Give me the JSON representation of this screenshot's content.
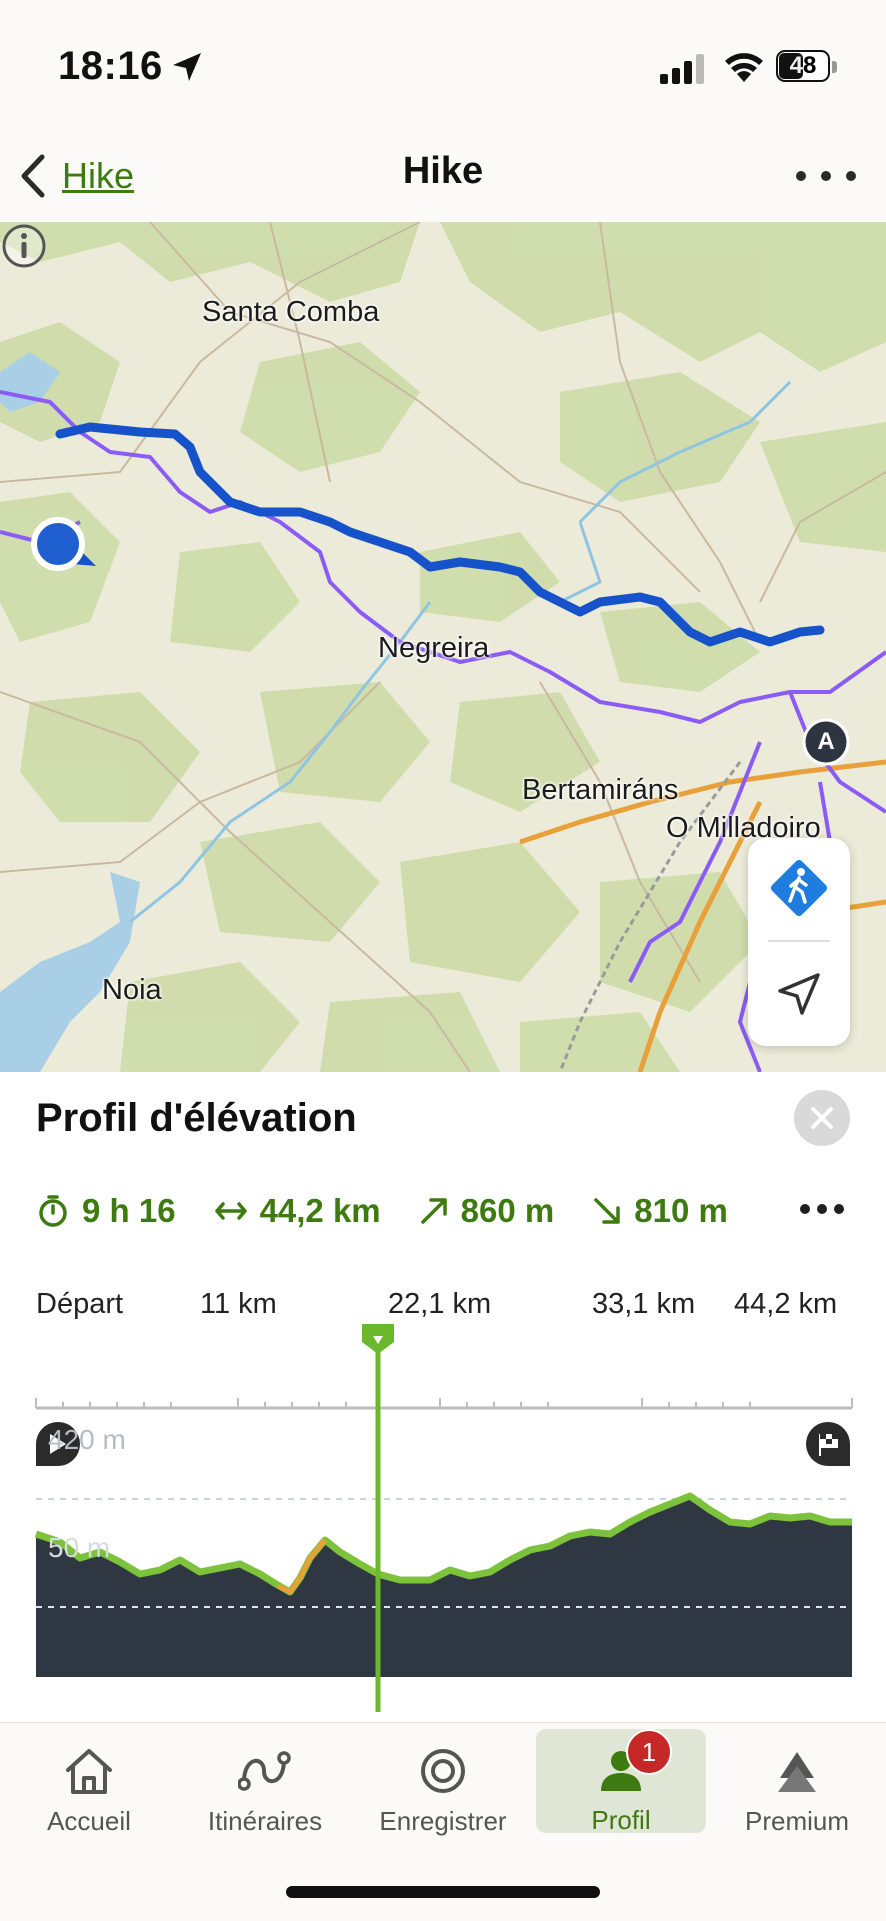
{
  "status_bar": {
    "time": "18:16",
    "battery": "48"
  },
  "nav": {
    "back_label": "Hike",
    "title": "Hike"
  },
  "map": {
    "labels": {
      "santa_comba": "Santa Comba",
      "negreira": "Negreira",
      "bertamirans": "Bertamiráns",
      "o_milladoiro": "O Milladoiro",
      "noia": "Noia"
    },
    "end_marker": "A"
  },
  "elevation": {
    "title": "Profil d'élévation",
    "stats": {
      "duration": "9 h 16",
      "distance": "44,2 km",
      "ascent": "860 m",
      "descent": "810 m"
    },
    "distance_axis": [
      "Départ",
      "11 km",
      "22,1 km",
      "33,1 km",
      "44,2 km"
    ],
    "elevation_labels": {
      "high": "420 m",
      "low": "50 m"
    }
  },
  "tabs": [
    {
      "label": "Accueil",
      "icon": "home-icon"
    },
    {
      "label": "Itinéraires",
      "icon": "routes-icon"
    },
    {
      "label": "Enregistrer",
      "icon": "record-icon"
    },
    {
      "label": "Profil",
      "icon": "profile-icon",
      "badge": "1",
      "active": true
    },
    {
      "label": "Premium",
      "icon": "premium-icon"
    }
  ],
  "colors": {
    "accent": "#3d7a0f",
    "route": "#1652c9",
    "profile_fill": "#2f3742",
    "badge": "#c62828"
  }
}
